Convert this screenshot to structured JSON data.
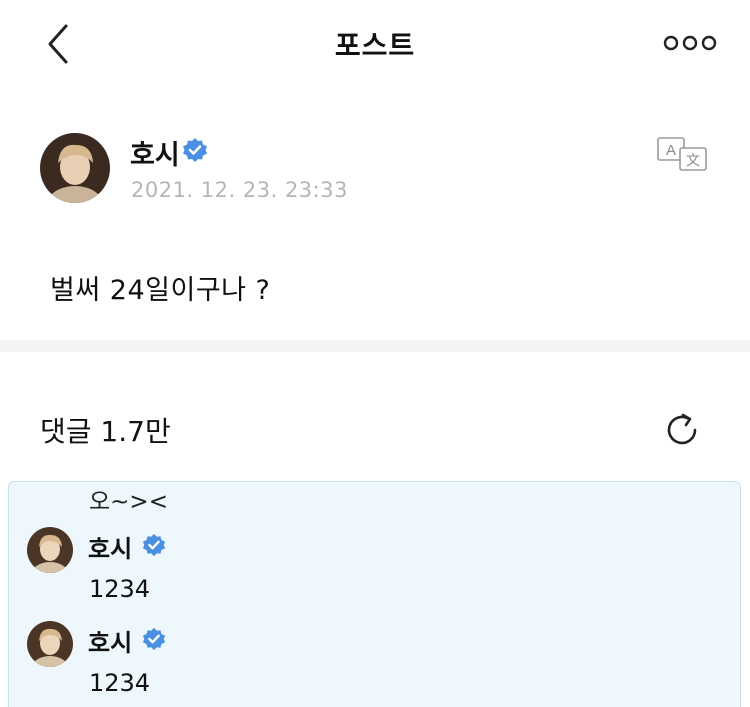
{
  "topbar": {
    "title": "포스트",
    "back_icon": "chevron-left-icon",
    "more_icon": "more-dots-icon"
  },
  "post": {
    "author": "호시",
    "date": "2021. 12. 23. 23:33",
    "body": "벌써 24일이구나 ?",
    "verified_color": "#4a90e2",
    "translate_icon": "translate-icon"
  },
  "comments": {
    "title": "댓글 1.7만",
    "refresh_icon": "refresh-icon",
    "top_text": "오~><",
    "replies": [
      {
        "author": "호시",
        "text": "1234"
      },
      {
        "author": "호시",
        "text": "1234"
      }
    ]
  },
  "colors": {
    "highlight_bg": "#eef7fc",
    "highlight_border": "#c7e2ef",
    "divider": "#f4f4f6",
    "date_text": "#b5b5b5"
  }
}
